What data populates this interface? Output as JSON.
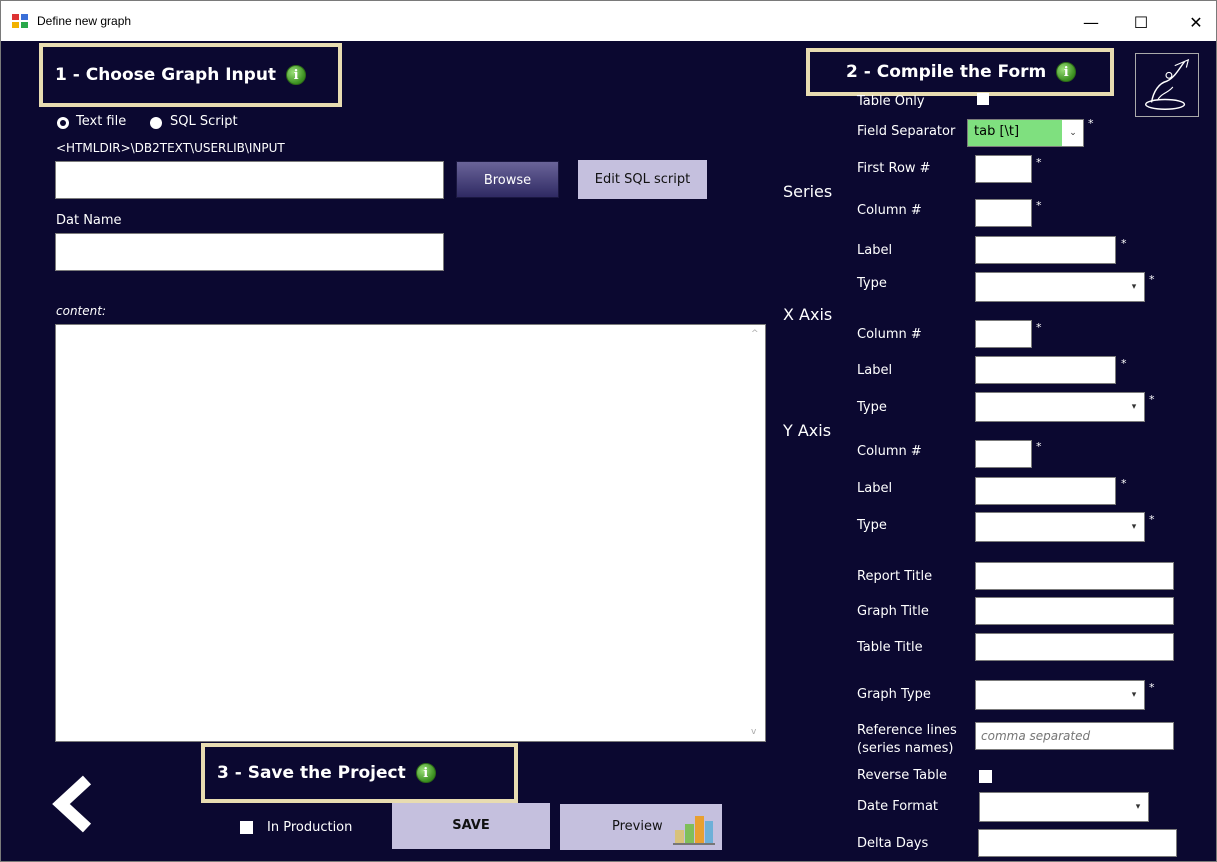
{
  "window": {
    "title": "Define new graph",
    "minimize": "—",
    "maximize": "☐",
    "close": "✕"
  },
  "step1": {
    "heading": "1 - Choose Graph Input",
    "radio_text_file": "Text file",
    "radio_sql_script": "SQL Script",
    "selected_source": "Text file",
    "path": "<HTMLDIR>\\DB2TEXT\\USERLIB\\INPUT",
    "file_value": "",
    "browse_label": "Browse",
    "edit_sql_label": "Edit SQL script",
    "dat_name_label": "Dat Name",
    "dat_name_value": "",
    "content_label": "content:",
    "content_value": ""
  },
  "step2": {
    "heading": "2 - Compile the Form",
    "table_only_label": "Table Only",
    "field_separator_label": "Field Separator",
    "field_separator_value": "tab [\\t]",
    "series_heading": "Series",
    "x_axis_heading": "X Axis",
    "y_axis_heading": "Y Axis",
    "first_row_label": "First Row #",
    "column_label": "Column #",
    "label_label": "Label",
    "type_label": "Type",
    "report_title_label": "Report Title",
    "graph_title_label": "Graph Title",
    "table_title_label": "Table Title",
    "graph_type_label": "Graph Type",
    "reference_lines_label_1": "Reference lines",
    "reference_lines_label_2": "(series names)",
    "reference_lines_placeholder": "comma separated",
    "reverse_table_label": "Reverse Table",
    "date_format_label": "Date Format",
    "delta_days_label": "Delta Days",
    "required_mark": "*"
  },
  "step3": {
    "heading": "3 - Save the Project",
    "in_production_label": "In Production",
    "save_label": "SAVE",
    "preview_label": "Preview"
  },
  "icons": {
    "info": "info-icon",
    "back": "chevron-left-icon",
    "logo": "logo-icon",
    "preview": "bar-chart-icon"
  },
  "colors": {
    "background": "#0b0830",
    "panel_border": "#e8dcb1",
    "browse_button": "#4a4580",
    "light_button": "#c5c0de",
    "separator_highlight": "#7fe07f",
    "info_green": "#3a8f1f"
  }
}
